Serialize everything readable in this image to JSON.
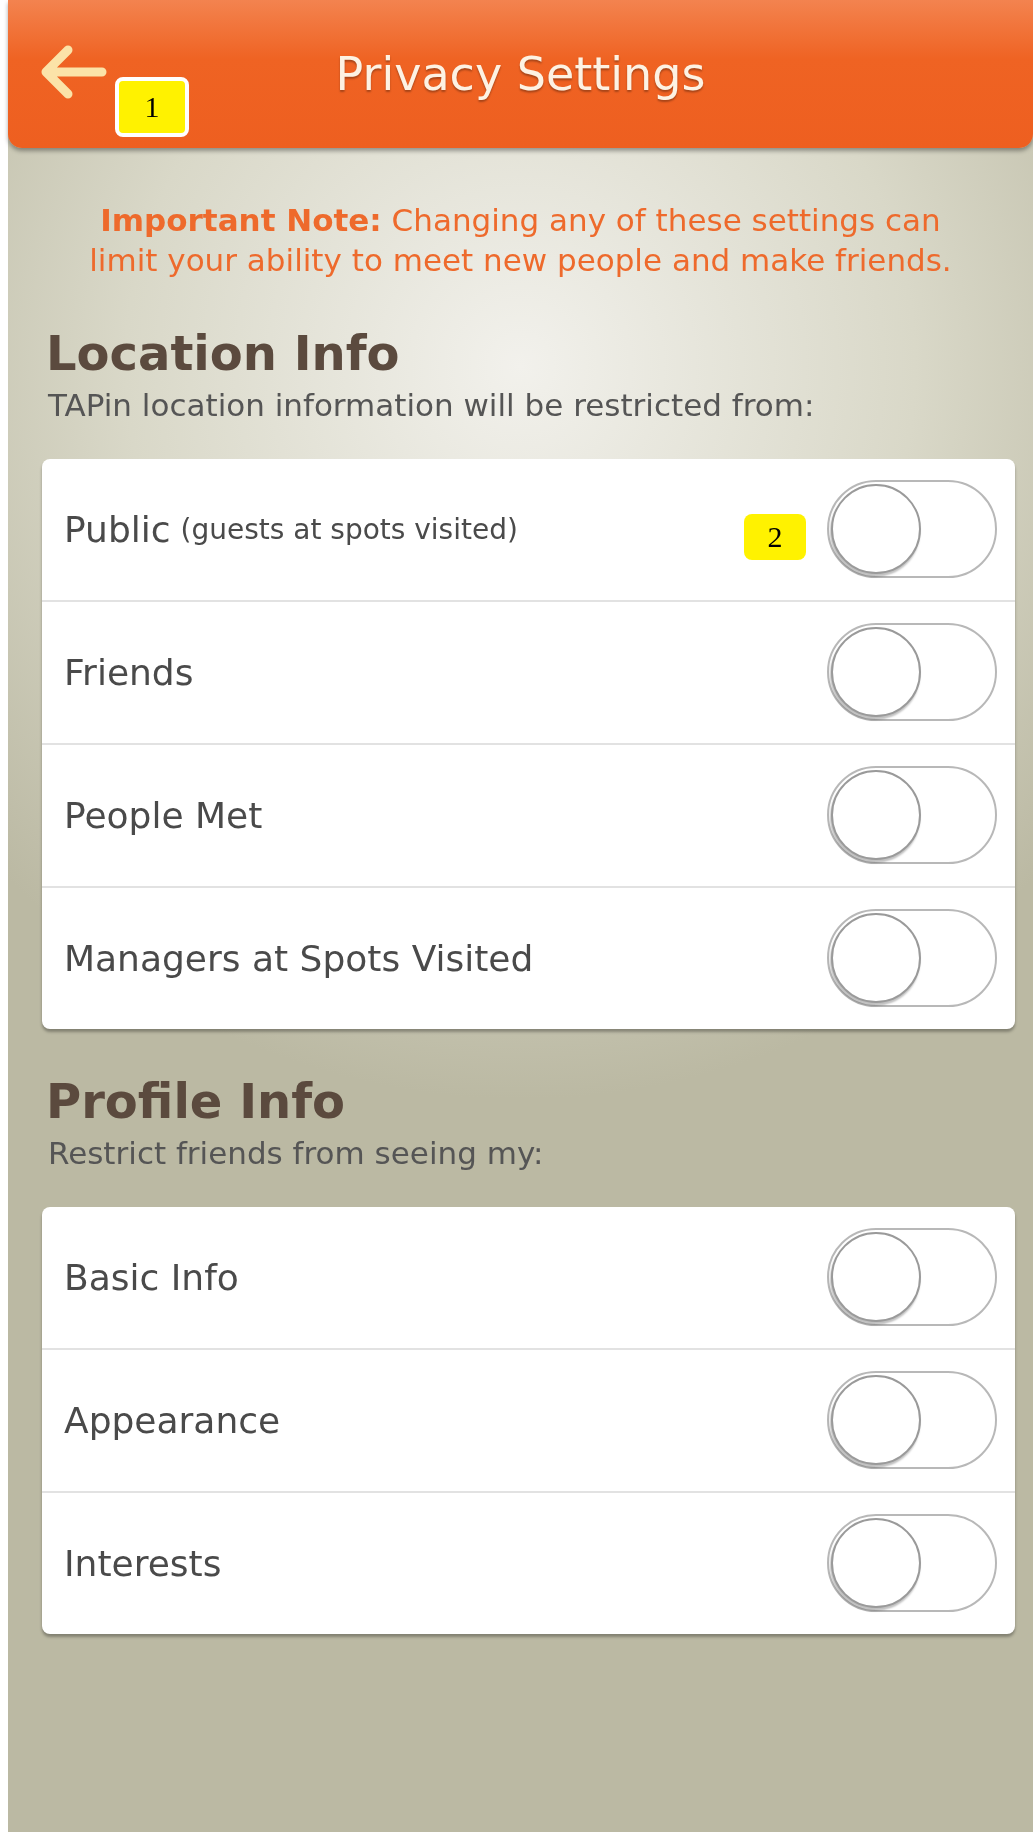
{
  "header": {
    "title": "Privacy Settings"
  },
  "note": "**Important Note:** Changing any of these settings can limit your ability to meet new people and make friends.",
  "sections": [
    {
      "title": "Location Info",
      "subtitle": "TAPin location information will be restricted from:",
      "items": [
        {
          "label": "Public",
          "detail": "(guests at spots visited)",
          "on": false
        },
        {
          "label": "Friends",
          "on": false
        },
        {
          "label": "People Met",
          "on": false
        },
        {
          "label": "Managers at Spots Visited",
          "on": false
        }
      ]
    },
    {
      "title": "Profile Info",
      "subtitle": "Restrict friends from seeing my:",
      "items": [
        {
          "label": "Basic Info",
          "on": false
        },
        {
          "label": "Appearance",
          "on": false
        },
        {
          "label": "Interests",
          "on": false
        }
      ]
    }
  ],
  "annotations": [
    "1",
    "2"
  ]
}
